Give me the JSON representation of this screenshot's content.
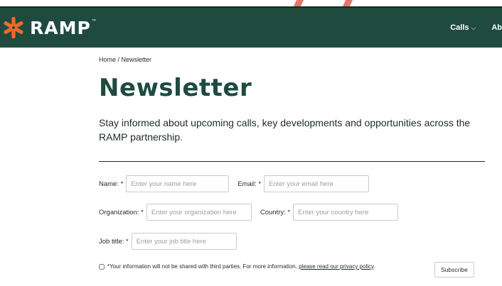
{
  "header": {
    "logo_text": "RAMP",
    "logo_tm": "™",
    "logo_icon": "asterisk-snowflake-icon",
    "brand_color": "#1f4b3f",
    "accent_color": "#f06a2b",
    "nav": [
      {
        "label": "Calls",
        "icon": "chevron-down-icon"
      },
      {
        "label": "Ab"
      }
    ]
  },
  "breadcrumb": "Home / Newsletter",
  "page_title": "Newsletter",
  "intro": "Stay informed about upcoming calls, key developments and opportunities across the RAMP partnership.",
  "form": {
    "name": {
      "label": "Name: *",
      "placeholder": "Enter your name here"
    },
    "email": {
      "label": "Email: *",
      "placeholder": "Enter your email here"
    },
    "organization": {
      "label": "Organization: *",
      "placeholder": "Enter your organization here"
    },
    "country": {
      "label": "Country: *",
      "placeholder": "Enter your country here"
    },
    "job_title": {
      "label": "Job title: *",
      "placeholder": "Enter your job title here"
    },
    "consent_text": "*Your information will not be shared with third parties. For more information,",
    "consent_link": "please read our privacy policy",
    "consent_end": ".",
    "subscribe_label": "Subscribe"
  }
}
